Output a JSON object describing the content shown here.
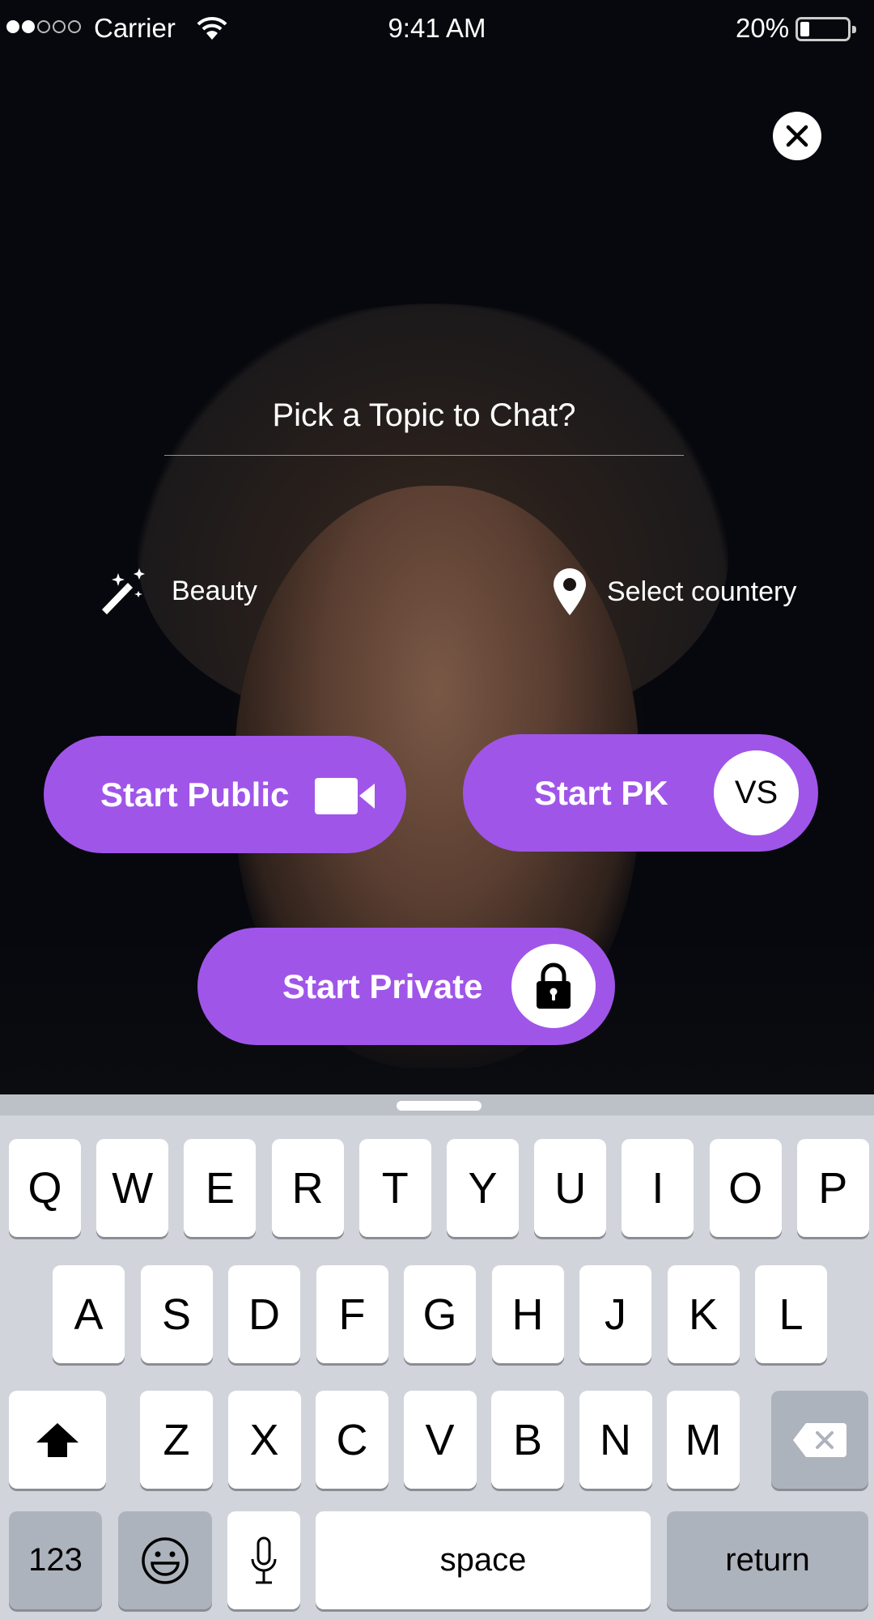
{
  "status_bar": {
    "signal_filled": 2,
    "signal_total": 5,
    "carrier": "Carrier",
    "time": "9:41 AM",
    "battery_percent_label": "20%",
    "battery_level": 0.2
  },
  "close_button": {
    "icon": "close-icon"
  },
  "topic": {
    "placeholder": "Pick a Topic to Chat?"
  },
  "options": {
    "beauty": {
      "label": "Beauty",
      "icon": "magic-wand-icon"
    },
    "country": {
      "label": "Select countery",
      "icon": "location-pin-icon"
    }
  },
  "buttons": {
    "start_public": {
      "label": "Start Public",
      "icon": "video-camera-icon"
    },
    "start_pk": {
      "label": "Start PK",
      "badge": "VS"
    },
    "start_private": {
      "label": "Start Private",
      "icon": "lock-icon"
    }
  },
  "colors": {
    "accent": "#a055e9",
    "keyboard_bg": "#d1d5db",
    "special_key": "#adb3bd"
  },
  "keyboard": {
    "row1": [
      "Q",
      "W",
      "E",
      "R",
      "T",
      "Y",
      "U",
      "I",
      "O",
      "P"
    ],
    "row2": [
      "A",
      "S",
      "D",
      "F",
      "G",
      "H",
      "J",
      "K",
      "L"
    ],
    "row3": [
      "Z",
      "X",
      "C",
      "V",
      "B",
      "N",
      "M"
    ],
    "shift_icon": "shift-arrow-icon",
    "delete_icon": "backspace-icon",
    "numbers": "123",
    "emoji_icon": "emoji-icon",
    "mic_icon": "microphone-icon",
    "space": "space",
    "return": "return"
  }
}
